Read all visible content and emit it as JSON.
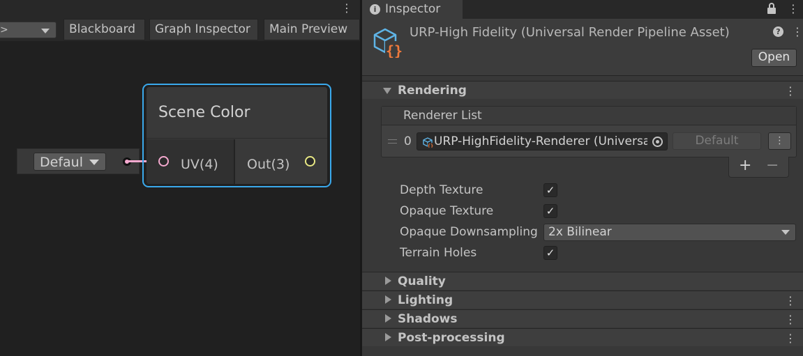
{
  "graph": {
    "toolbar": {
      "dropdown_fragment": ">",
      "blackboard": "Blackboard",
      "graph_inspector": "Graph Inspector",
      "main_preview": "Main Preview"
    },
    "default_value": "Defaul",
    "node": {
      "title": "Scene Color",
      "input_port": "UV(4)",
      "output_port": "Out(3)"
    },
    "colors": {
      "selection": "#3aa9ec",
      "uv_port": "#f5a9cf",
      "out_port": "#e8e884"
    },
    "icons": [
      "kebab-menu-icon",
      "dropdown-arrow-icon",
      "port-icon"
    ]
  },
  "inspector": {
    "tab_label": "Inspector",
    "asset_title": "URP-High Fidelity (Universal Render Pipeline Asset)",
    "open_label": "Open",
    "icons": [
      "info-icon",
      "lock-icon",
      "kebab-menu-icon",
      "asset-icon",
      "help-icon"
    ],
    "sections": {
      "rendering": "Rendering",
      "quality": "Quality",
      "lighting": "Lighting",
      "shadows": "Shadows",
      "post_processing": "Post-processing"
    },
    "renderer_list": {
      "header": "Renderer List",
      "index": "0",
      "renderer_value": "URP-HighFidelity-Renderer (Universal Renderer Data)",
      "default_label": "Default",
      "menu_label": "⋮",
      "add_label": "+",
      "remove_label": "−"
    },
    "properties": {
      "depth_texture": {
        "label": "Depth Texture",
        "checked": true
      },
      "opaque_texture": {
        "label": "Opaque Texture",
        "checked": true
      },
      "opaque_downsampling": {
        "label": "Opaque Downsampling",
        "value": "2x Bilinear"
      },
      "terrain_holes": {
        "label": "Terrain Holes",
        "checked": true
      }
    },
    "checkmark": "✓",
    "kebab": "⋮",
    "accent_colors": {
      "asset_cube": "#5fb4e6",
      "asset_braces": "#f07a3c"
    }
  }
}
